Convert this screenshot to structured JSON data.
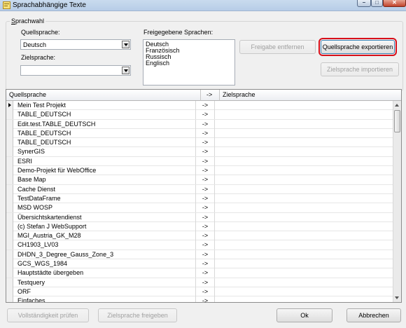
{
  "window": {
    "title": "Sprachabhängige Texte"
  },
  "group": {
    "legend_underlined": "S",
    "legend_rest": "prachwahl"
  },
  "source": {
    "label": "Quellsprache:",
    "value": "Deutsch"
  },
  "target": {
    "label": "Zielsprache:",
    "value": ""
  },
  "released": {
    "label": "Freigegebene Sprachen:",
    "items": [
      "Deutsch",
      "Französisch",
      "Russisch",
      "Englisch"
    ]
  },
  "buttons": {
    "remove_release": "Freigabe entfernen",
    "export_source": "Quellsprache exportieren",
    "import_target": "Zielsprache importieren",
    "check_complete": "Vollständigkeit prüfen",
    "release_target": "Zielsprache freigeben",
    "ok": "Ok",
    "cancel": "Abbrechen"
  },
  "table": {
    "headers": [
      "Quellsprache",
      "->",
      "Zielsprache"
    ],
    "rows": [
      "Mein Test Projekt",
      "TABLE_DEUTSCH",
      "Edit.test.TABLE_DEUTSCH",
      "TABLE_DEUTSCH",
      "TABLE_DEUTSCH",
      "SynerGIS",
      "ESRI",
      "Demo-Projekt für WebOffice",
      "Base Map",
      "Cache Dienst",
      "TestDataFrame",
      "MSD WOSP",
      "Übersichtskartendienst",
      "(c) Stefan J WebSupport",
      "MGI_Austria_GK_M28",
      "CH1903_LV03",
      "DHDN_3_Degree_Gauss_Zone_3",
      "GCS_WGS_1984",
      "Hauptstädte übergeben",
      "Testquery",
      "ORF",
      "Einfaches"
    ],
    "arrow": "->"
  },
  "colors": {
    "highlight": "#d8101a",
    "close_button": "#c2432b"
  }
}
